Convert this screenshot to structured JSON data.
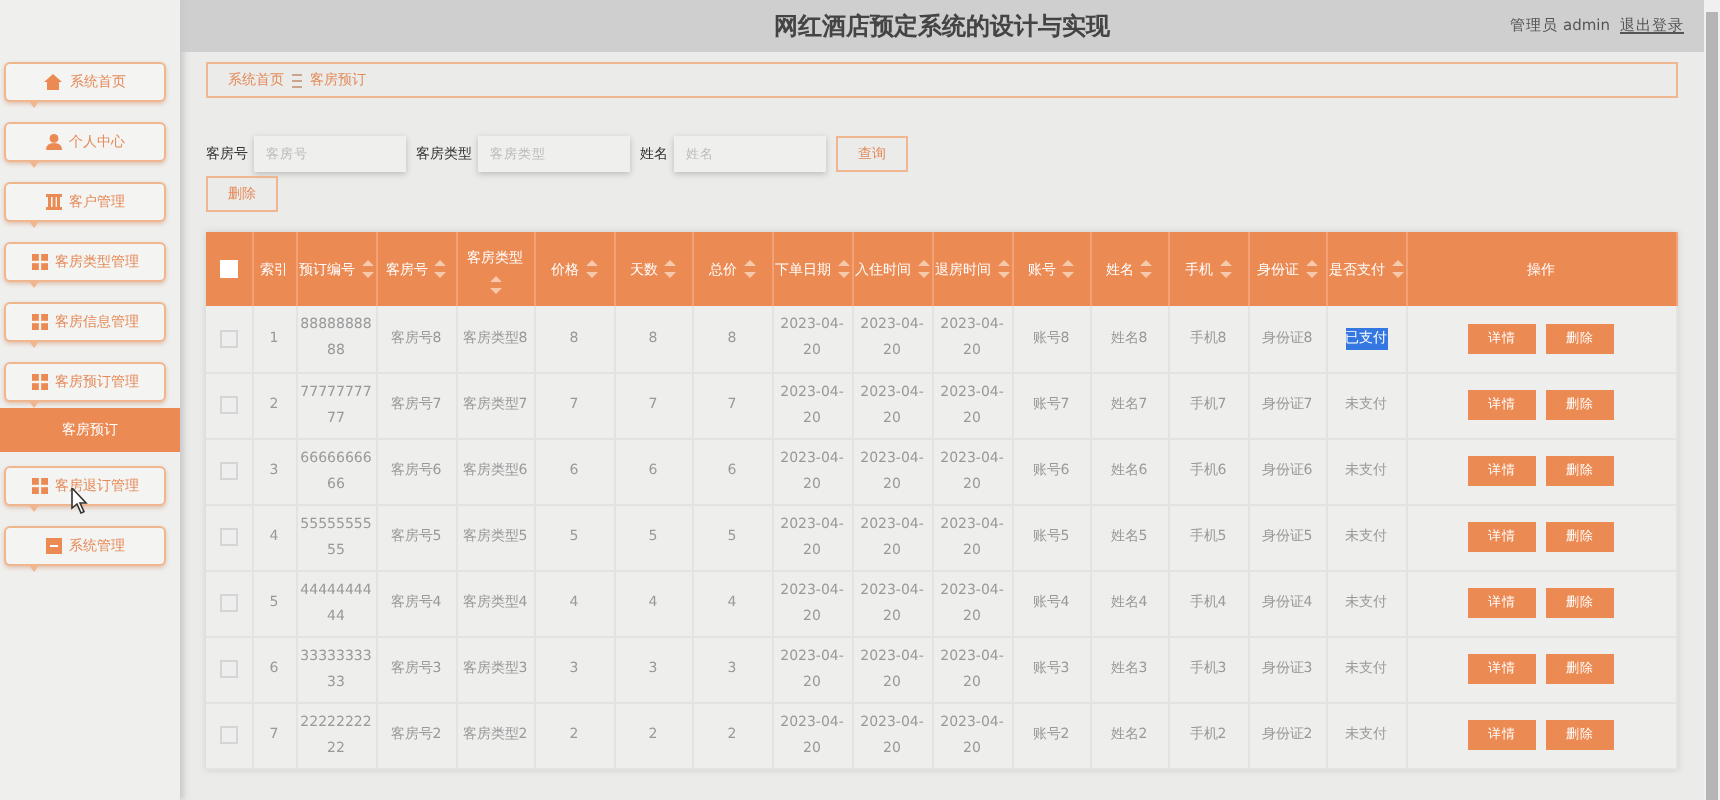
{
  "header": {
    "title": "网红酒店预定系统的设计与实现",
    "user": "管理员 admin",
    "logout": "退出登录"
  },
  "sidebar": {
    "items": [
      {
        "label": "系统首页",
        "kind": "home",
        "selected": false
      },
      {
        "label": "个人中心",
        "kind": "user",
        "selected": false
      },
      {
        "label": "客户管理",
        "kind": "list",
        "selected": false
      },
      {
        "label": "客房类型管理",
        "kind": "grid",
        "selected": false
      },
      {
        "label": "客房信息管理",
        "kind": "grid",
        "selected": false
      },
      {
        "label": "客房预订管理",
        "kind": "grid",
        "selected": false
      },
      {
        "label": "客房预订",
        "kind": "submenu",
        "selected": true
      },
      {
        "label": "客房退订管理",
        "kind": "grid",
        "selected": false
      },
      {
        "label": "系统管理",
        "kind": "square",
        "selected": false
      }
    ]
  },
  "breadcrumb": [
    "系统首页",
    "客房预订"
  ],
  "search": {
    "fields": [
      {
        "label": "客房号",
        "placeholder": "客房号"
      },
      {
        "label": "客房类型",
        "placeholder": "客房类型"
      },
      {
        "label": "姓名",
        "placeholder": "姓名"
      }
    ],
    "button": "查询"
  },
  "delete_button": "删除",
  "table": {
    "select_all": {
      "checked": false
    },
    "columns": [
      {
        "label": "索引",
        "sortable": false
      },
      {
        "label": "预订编号",
        "sortable": true
      },
      {
        "label": "客房号",
        "sortable": true
      },
      {
        "label": "客房类型",
        "sortable": true
      },
      {
        "label": "价格",
        "sortable": true
      },
      {
        "label": "天数",
        "sortable": true
      },
      {
        "label": "总价",
        "sortable": true
      },
      {
        "label": "下单日期",
        "sortable": true
      },
      {
        "label": "入住时间",
        "sortable": true
      },
      {
        "label": "退房时间",
        "sortable": true
      },
      {
        "label": "账号",
        "sortable": true
      },
      {
        "label": "姓名",
        "sortable": true
      },
      {
        "label": "手机",
        "sortable": true
      },
      {
        "label": "身份证",
        "sortable": true
      },
      {
        "label": "是否支付",
        "sortable": true
      },
      {
        "label": "操作",
        "sortable": false
      }
    ],
    "rows": [
      {
        "checked": false,
        "cells": [
          "1",
          "8888888888",
          "客房号8",
          "客房类型8",
          "8",
          "8",
          "8",
          "2023-04-20",
          "2023-04-20",
          "2023-04-20",
          "账号8",
          "姓名8",
          "手机8",
          "身份证8",
          "已支付"
        ],
        "text_selected": true,
        "actions": [
          "详情",
          "删除"
        ]
      },
      {
        "checked": false,
        "cells": [
          "2",
          "7777777777",
          "客房号7",
          "客房类型7",
          "7",
          "7",
          "7",
          "2023-04-20",
          "2023-04-20",
          "2023-04-20",
          "账号7",
          "姓名7",
          "手机7",
          "身份证7",
          "未支付"
        ],
        "text_selected": false,
        "actions": [
          "详情",
          "删除"
        ]
      },
      {
        "checked": false,
        "cells": [
          "3",
          "6666666666",
          "客房号6",
          "客房类型6",
          "6",
          "6",
          "6",
          "2023-04-20",
          "2023-04-20",
          "2023-04-20",
          "账号6",
          "姓名6",
          "手机6",
          "身份证6",
          "未支付"
        ],
        "text_selected": false,
        "actions": [
          "详情",
          "删除"
        ]
      },
      {
        "checked": false,
        "cells": [
          "4",
          "5555555555",
          "客房号5",
          "客房类型5",
          "5",
          "5",
          "5",
          "2023-04-20",
          "2023-04-20",
          "2023-04-20",
          "账号5",
          "姓名5",
          "手机5",
          "身份证5",
          "未支付"
        ],
        "text_selected": false,
        "actions": [
          "详情",
          "删除"
        ]
      },
      {
        "checked": false,
        "cells": [
          "5",
          "4444444444",
          "客房号4",
          "客房类型4",
          "4",
          "4",
          "4",
          "2023-04-20",
          "2023-04-20",
          "2023-04-20",
          "账号4",
          "姓名4",
          "手机4",
          "身份证4",
          "未支付"
        ],
        "text_selected": false,
        "actions": [
          "详情",
          "删除"
        ]
      },
      {
        "checked": false,
        "cells": [
          "6",
          "3333333333",
          "客房号3",
          "客房类型3",
          "3",
          "3",
          "3",
          "2023-04-20",
          "2023-04-20",
          "2023-04-20",
          "账号3",
          "姓名3",
          "手机3",
          "身份证3",
          "未支付"
        ],
        "text_selected": false,
        "actions": [
          "详情",
          "删除"
        ]
      },
      {
        "checked": false,
        "cells": [
          "7",
          "2222222222",
          "客房号2",
          "客房类型2",
          "2",
          "2",
          "2",
          "2023-04-20",
          "2023-04-20",
          "2023-04-20",
          "账号2",
          "姓名2",
          "手机2",
          "身份证2",
          "未支付"
        ],
        "text_selected": false,
        "actions": [
          "详情",
          "删除"
        ]
      }
    ]
  }
}
